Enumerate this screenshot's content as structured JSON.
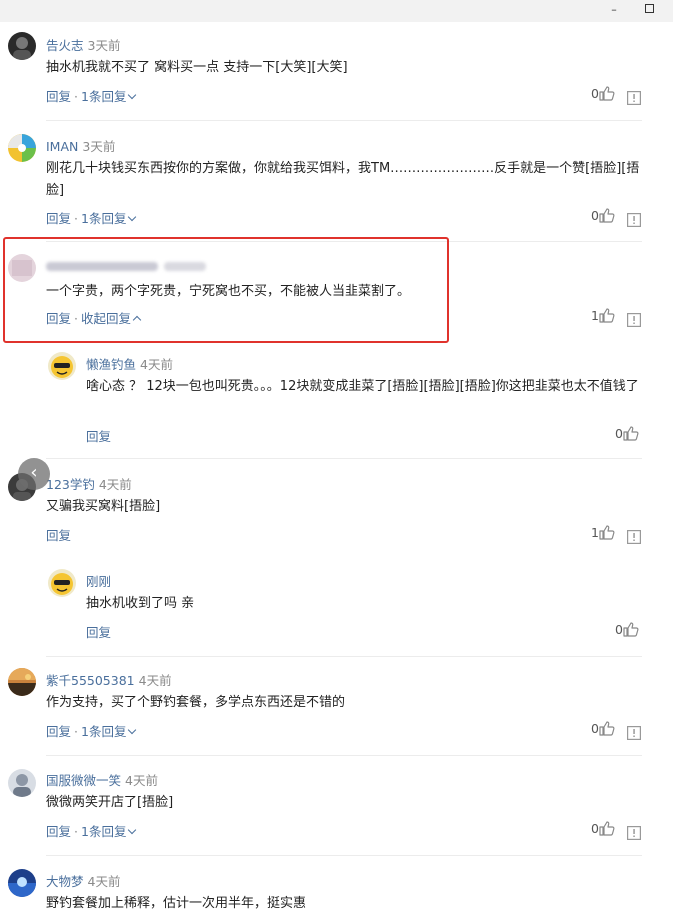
{
  "window": {
    "minimize_glyph": "–"
  },
  "comments": [
    {
      "user": "告火志",
      "time": "3天前",
      "text": "抽水机我就不买了 窝料买一点 支持一下[大笑][大笑]",
      "reply_label": "回复",
      "sep": "·",
      "toggle_label": "1条回复",
      "likes": "0"
    },
    {
      "user": "IMAN",
      "time": "3天前",
      "text": "刚花几十块钱买东西按你的方案做，你就给我买饵料，我TM……………………反手就是一个赞[捂脸][捂脸]",
      "reply_label": "回复",
      "sep": "·",
      "toggle_label": "1条回复",
      "likes": "0"
    },
    {
      "user": "",
      "time": "",
      "text": "一个字贵，两个字死贵，宁死窝也不买，不能被人当韭菜割了。",
      "reply_label": "回复",
      "sep": "·",
      "toggle_label": "收起回复",
      "likes": "1"
    },
    {
      "user": "懒渔钓鱼",
      "time": "4天前",
      "text": "啥心态 ？ 12块一包也叫死贵。。。12块就变成韭菜了[捂脸][捂脸][捂脸]你这把韭菜也太不值钱了",
      "reply_label": "回复",
      "likes": "0"
    },
    {
      "user": "123学钓",
      "time": "4天前",
      "text": "又骗我买窝料[捂脸]",
      "reply_label": "回复",
      "likes": "1"
    },
    {
      "user": "刚刚",
      "time": "",
      "text": "抽水机收到了吗 亲",
      "reply_label": "回复",
      "likes": "0"
    },
    {
      "user": "紫千55505381",
      "time": "4天前",
      "text": "作为支持，买了个野钓套餐，多学点东西还是不错的",
      "reply_label": "回复",
      "sep": "·",
      "toggle_label": "1条回复",
      "likes": "0"
    },
    {
      "user": "国服微微一笑",
      "time": "4天前",
      "text": "微微两笑开店了[捂脸]",
      "reply_label": "回复",
      "sep": "·",
      "toggle_label": "1条回复",
      "likes": "0"
    },
    {
      "user": "大物梦",
      "time": "4天前",
      "text": "野钓套餐加上稀释，估计一次用半年，挺实惠"
    }
  ],
  "nav_back_glyph": "‹",
  "colors": {
    "link": "#4a6f9c",
    "highlight": "#e0322c"
  }
}
